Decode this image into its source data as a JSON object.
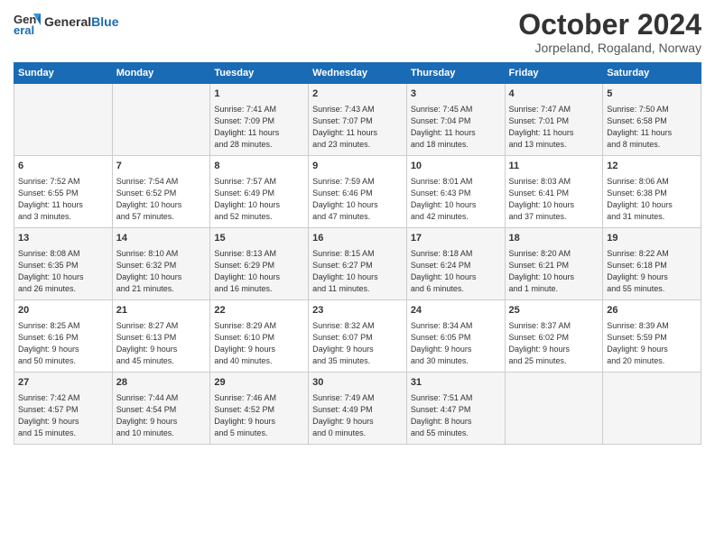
{
  "logo": {
    "general": "General",
    "blue": "Blue"
  },
  "title": "October 2024",
  "subtitle": "Jorpeland, Rogaland, Norway",
  "headers": [
    "Sunday",
    "Monday",
    "Tuesday",
    "Wednesday",
    "Thursday",
    "Friday",
    "Saturday"
  ],
  "weeks": [
    [
      {
        "day": "",
        "content": ""
      },
      {
        "day": "",
        "content": ""
      },
      {
        "day": "1",
        "content": "Sunrise: 7:41 AM\nSunset: 7:09 PM\nDaylight: 11 hours\nand 28 minutes."
      },
      {
        "day": "2",
        "content": "Sunrise: 7:43 AM\nSunset: 7:07 PM\nDaylight: 11 hours\nand 23 minutes."
      },
      {
        "day": "3",
        "content": "Sunrise: 7:45 AM\nSunset: 7:04 PM\nDaylight: 11 hours\nand 18 minutes."
      },
      {
        "day": "4",
        "content": "Sunrise: 7:47 AM\nSunset: 7:01 PM\nDaylight: 11 hours\nand 13 minutes."
      },
      {
        "day": "5",
        "content": "Sunrise: 7:50 AM\nSunset: 6:58 PM\nDaylight: 11 hours\nand 8 minutes."
      }
    ],
    [
      {
        "day": "6",
        "content": "Sunrise: 7:52 AM\nSunset: 6:55 PM\nDaylight: 11 hours\nand 3 minutes."
      },
      {
        "day": "7",
        "content": "Sunrise: 7:54 AM\nSunset: 6:52 PM\nDaylight: 10 hours\nand 57 minutes."
      },
      {
        "day": "8",
        "content": "Sunrise: 7:57 AM\nSunset: 6:49 PM\nDaylight: 10 hours\nand 52 minutes."
      },
      {
        "day": "9",
        "content": "Sunrise: 7:59 AM\nSunset: 6:46 PM\nDaylight: 10 hours\nand 47 minutes."
      },
      {
        "day": "10",
        "content": "Sunrise: 8:01 AM\nSunset: 6:43 PM\nDaylight: 10 hours\nand 42 minutes."
      },
      {
        "day": "11",
        "content": "Sunrise: 8:03 AM\nSunset: 6:41 PM\nDaylight: 10 hours\nand 37 minutes."
      },
      {
        "day": "12",
        "content": "Sunrise: 8:06 AM\nSunset: 6:38 PM\nDaylight: 10 hours\nand 31 minutes."
      }
    ],
    [
      {
        "day": "13",
        "content": "Sunrise: 8:08 AM\nSunset: 6:35 PM\nDaylight: 10 hours\nand 26 minutes."
      },
      {
        "day": "14",
        "content": "Sunrise: 8:10 AM\nSunset: 6:32 PM\nDaylight: 10 hours\nand 21 minutes."
      },
      {
        "day": "15",
        "content": "Sunrise: 8:13 AM\nSunset: 6:29 PM\nDaylight: 10 hours\nand 16 minutes."
      },
      {
        "day": "16",
        "content": "Sunrise: 8:15 AM\nSunset: 6:27 PM\nDaylight: 10 hours\nand 11 minutes."
      },
      {
        "day": "17",
        "content": "Sunrise: 8:18 AM\nSunset: 6:24 PM\nDaylight: 10 hours\nand 6 minutes."
      },
      {
        "day": "18",
        "content": "Sunrise: 8:20 AM\nSunset: 6:21 PM\nDaylight: 10 hours\nand 1 minute."
      },
      {
        "day": "19",
        "content": "Sunrise: 8:22 AM\nSunset: 6:18 PM\nDaylight: 9 hours\nand 55 minutes."
      }
    ],
    [
      {
        "day": "20",
        "content": "Sunrise: 8:25 AM\nSunset: 6:16 PM\nDaylight: 9 hours\nand 50 minutes."
      },
      {
        "day": "21",
        "content": "Sunrise: 8:27 AM\nSunset: 6:13 PM\nDaylight: 9 hours\nand 45 minutes."
      },
      {
        "day": "22",
        "content": "Sunrise: 8:29 AM\nSunset: 6:10 PM\nDaylight: 9 hours\nand 40 minutes."
      },
      {
        "day": "23",
        "content": "Sunrise: 8:32 AM\nSunset: 6:07 PM\nDaylight: 9 hours\nand 35 minutes."
      },
      {
        "day": "24",
        "content": "Sunrise: 8:34 AM\nSunset: 6:05 PM\nDaylight: 9 hours\nand 30 minutes."
      },
      {
        "day": "25",
        "content": "Sunrise: 8:37 AM\nSunset: 6:02 PM\nDaylight: 9 hours\nand 25 minutes."
      },
      {
        "day": "26",
        "content": "Sunrise: 8:39 AM\nSunset: 5:59 PM\nDaylight: 9 hours\nand 20 minutes."
      }
    ],
    [
      {
        "day": "27",
        "content": "Sunrise: 7:42 AM\nSunset: 4:57 PM\nDaylight: 9 hours\nand 15 minutes."
      },
      {
        "day": "28",
        "content": "Sunrise: 7:44 AM\nSunset: 4:54 PM\nDaylight: 9 hours\nand 10 minutes."
      },
      {
        "day": "29",
        "content": "Sunrise: 7:46 AM\nSunset: 4:52 PM\nDaylight: 9 hours\nand 5 minutes."
      },
      {
        "day": "30",
        "content": "Sunrise: 7:49 AM\nSunset: 4:49 PM\nDaylight: 9 hours\nand 0 minutes."
      },
      {
        "day": "31",
        "content": "Sunrise: 7:51 AM\nSunset: 4:47 PM\nDaylight: 8 hours\nand 55 minutes."
      },
      {
        "day": "",
        "content": ""
      },
      {
        "day": "",
        "content": ""
      }
    ]
  ]
}
